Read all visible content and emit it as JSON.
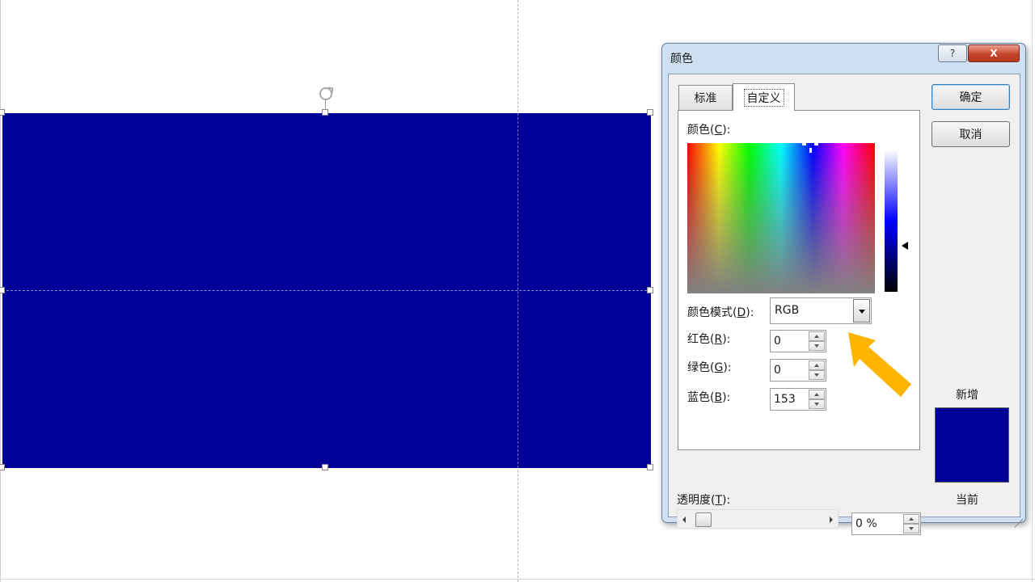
{
  "dialog": {
    "title": "颜色",
    "help_label": "?",
    "close_label": "X",
    "tabs": [
      {
        "label": "标准",
        "selected": false
      },
      {
        "label": "自定义",
        "selected": true
      }
    ],
    "colors_label_prefix": "颜色(",
    "colors_label_key": "C",
    "colors_label_suffix": "):",
    "color_model_label_prefix": "颜色模式(",
    "color_model_label_key": "D",
    "color_model_label_suffix": "):",
    "color_model_value": "RGB",
    "red_label_prefix": "红色(",
    "red_label_key": "R",
    "red_label_suffix": "):",
    "red_value": "0",
    "green_label_prefix": "绿色(",
    "green_label_key": "G",
    "green_label_suffix": "):",
    "green_value": "0",
    "blue_label_prefix": "蓝色(",
    "blue_label_key": "B",
    "blue_label_suffix": "):",
    "blue_value": "153",
    "transparency_label_prefix": "透明度(",
    "transparency_label_key": "T",
    "transparency_label_suffix": "):",
    "transparency_value": "0 %",
    "ok_label": "确定",
    "cancel_label": "取消",
    "new_label": "新增",
    "current_label": "当前"
  },
  "colors": {
    "shape_fill": "#000099",
    "new_swatch": "#000099",
    "current_swatch": "#000099",
    "callout_arrow": "#ffb400"
  },
  "icons": {
    "rotate": "rotate-handle-icon",
    "dropdown": "chevron-down-icon",
    "callout": "arrow-callout-icon"
  }
}
